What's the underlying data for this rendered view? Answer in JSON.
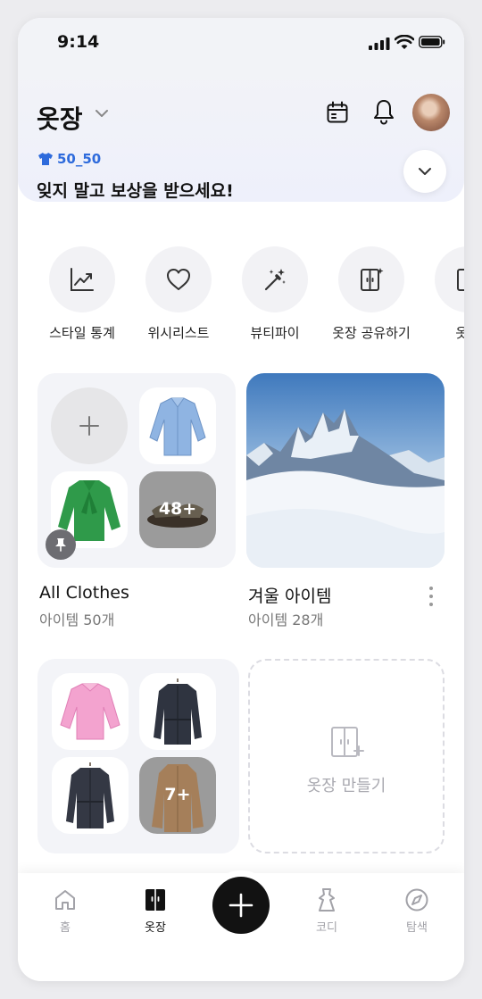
{
  "status_bar": {
    "time": "9:14"
  },
  "header": {
    "title": "옷장",
    "promo_code": "50_50",
    "promo_text": "잊지 말고 보상을 받으세요!"
  },
  "shortcuts": [
    {
      "label": "스타일 통계",
      "icon": "chart-icon"
    },
    {
      "label": "위시리스트",
      "icon": "heart-icon"
    },
    {
      "label": "뷰티파이",
      "icon": "magic-wand-icon"
    },
    {
      "label": "옷장 공유하기",
      "icon": "wardrobe-share-icon"
    },
    {
      "label": "옷장",
      "icon": "wardrobe-icon"
    }
  ],
  "collections": [
    {
      "name": "All Clothes",
      "count": "아이템 50개",
      "more": "48+"
    },
    {
      "name": "겨울 아이템",
      "count": "아이템 28개"
    },
    {
      "more": "7+"
    }
  ],
  "create_label": "옷장 만들기",
  "tabs": [
    {
      "label": "홈"
    },
    {
      "label": "옷장"
    },
    {
      "label": "코디"
    },
    {
      "label": "탐색"
    }
  ],
  "colors": {
    "accent": "#2e6bdc",
    "fab": "#121212"
  }
}
